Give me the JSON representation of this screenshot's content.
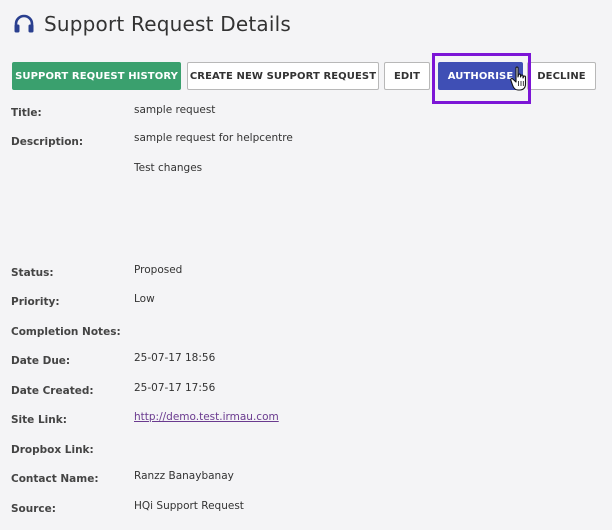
{
  "header": {
    "title": "Support Request Details",
    "icon": "headset-icon"
  },
  "toolbar": {
    "history_label": "SUPPORT REQUEST HISTORY",
    "create_label": "CREATE NEW SUPPORT REQUEST",
    "edit_label": "EDIT",
    "authorise_label": "AUTHORISE",
    "decline_label": "DECLINE"
  },
  "colors": {
    "accent_green": "#3aa06e",
    "accent_blue": "#3f4fb5",
    "highlight": "#7c15d6"
  },
  "details": {
    "title_label": "Title:",
    "title_value": "sample request",
    "description_label": "Description:",
    "description_value_1": "sample request for helpcentre",
    "description_value_2": "Test changes",
    "status_label": "Status:",
    "status_value": "Proposed",
    "priority_label": "Priority:",
    "priority_value": "Low",
    "completion_label": "Completion Notes:",
    "date_due_label": "Date Due:",
    "date_due_value": "25-07-17 18:56",
    "date_created_label": "Date Created:",
    "date_created_value": "25-07-17 17:56",
    "site_link_label": "Site Link:",
    "site_link_value": "http://demo.test.irmau.com",
    "dropbox_label": "Dropbox Link:",
    "contact_label": "Contact Name:",
    "contact_value": "Ranzz Banaybanay",
    "source_label": "Source:",
    "source_value": "HQi Support Request"
  }
}
